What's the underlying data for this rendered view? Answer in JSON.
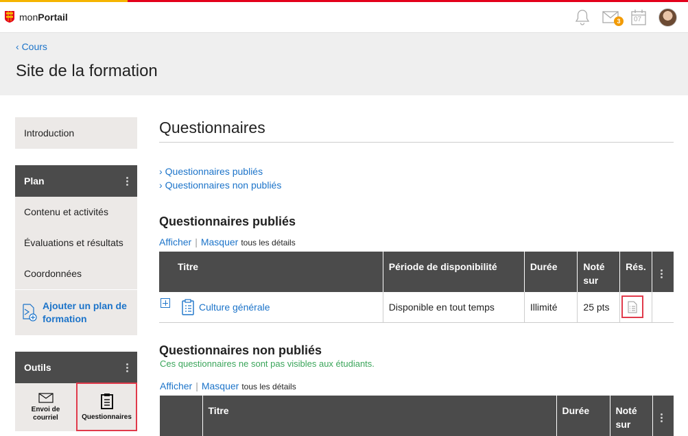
{
  "app": {
    "logo_prefix": "mon",
    "logo_bold": "Portail",
    "mail_badge": "3",
    "calendar_day": "07"
  },
  "header": {
    "back_link": "Cours",
    "title": "Site de la formation"
  },
  "sidebar": {
    "intro": "Introduction",
    "plan": {
      "title": "Plan",
      "items": [
        "Contenu et activités",
        "Évaluations et résultats",
        "Coordonnées"
      ],
      "add_plan": "Ajouter un plan de formation"
    },
    "tools": {
      "title": "Outils",
      "items": [
        "Envoi de courriel",
        "Questionnaires"
      ]
    }
  },
  "main": {
    "title": "Questionnaires",
    "anchors": [
      "Questionnaires publiés",
      "Questionnaires non publiés"
    ],
    "published": {
      "title": "Questionnaires publiés",
      "show": "Afficher",
      "hide": "Masquer",
      "details": "tous les détails",
      "columns": [
        "Titre",
        "Période de disponibilité",
        "Durée",
        "Noté sur",
        "Rés."
      ],
      "rows": [
        {
          "title": "Culture générale",
          "period": "Disponible en tout temps",
          "duration": "Illimité",
          "score": "25 pts"
        }
      ]
    },
    "unpublished": {
      "title": "Questionnaires non publiés",
      "note": "Ces questionnaires ne sont pas visibles aux étudiants.",
      "show": "Afficher",
      "hide": "Masquer",
      "details": "tous les détails",
      "columns": [
        "Titre",
        "Durée",
        "Noté sur"
      ]
    }
  },
  "colors": {
    "accent": "#1b73c9",
    "header_dark": "#4b4b4b",
    "highlight": "#e0394a",
    "success": "#3aa55a",
    "badge": "#f29b05"
  }
}
